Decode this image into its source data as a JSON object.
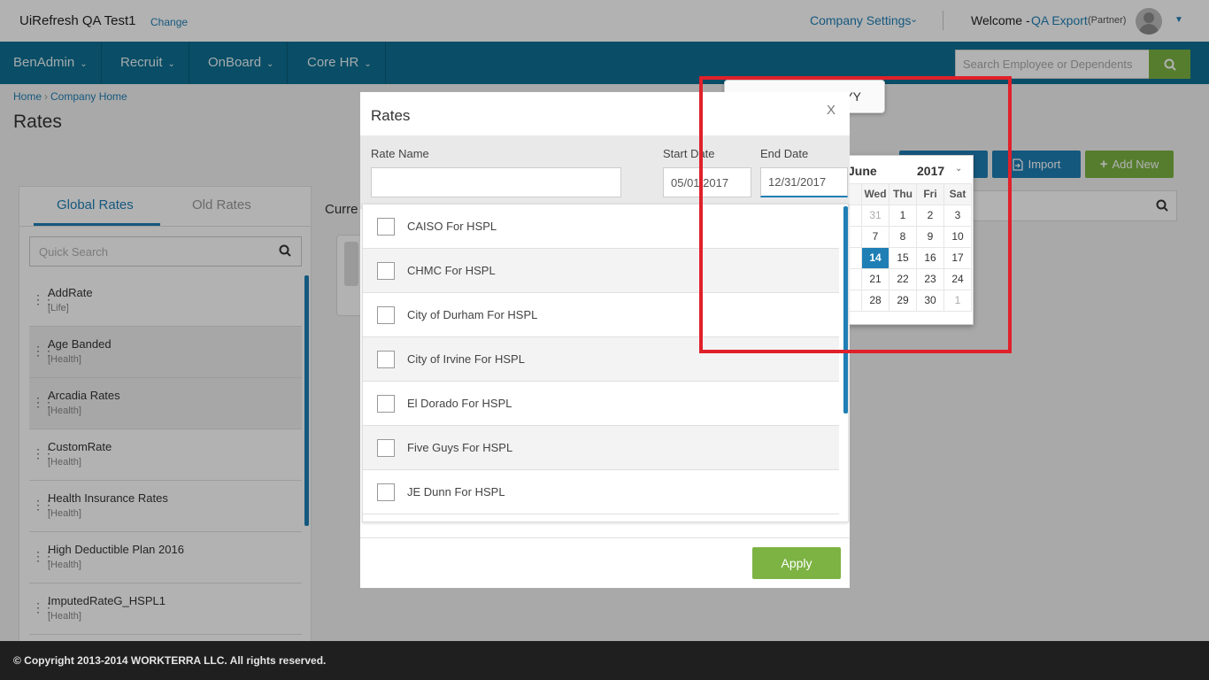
{
  "header": {
    "app_title": "UiRefresh QA Test1",
    "change_link": "Change",
    "company_settings": "Company Settings",
    "welcome": "Welcome -",
    "user": "QA Export",
    "role": "(Partner)"
  },
  "nav": {
    "items": [
      {
        "label": "BenAdmin"
      },
      {
        "label": "Recruit"
      },
      {
        "label": "OnBoard"
      },
      {
        "label": "Core HR"
      }
    ],
    "search_placeholder": "Search Employee or Dependents"
  },
  "breadcrumb": {
    "home": "Home",
    "company_home": "Company Home"
  },
  "page_title": "Rates",
  "left_panel": {
    "tabs": [
      "Global Rates",
      "Old Rates"
    ],
    "quick_search_placeholder": "Quick Search",
    "rates": [
      {
        "name": "AddRate",
        "type": "[Life]"
      },
      {
        "name": "Age Banded",
        "type": "[Health]"
      },
      {
        "name": "Arcadia Rates",
        "type": "[Health]"
      },
      {
        "name": "CustomRate",
        "type": "[Health]"
      },
      {
        "name": "Health Insurance Rates",
        "type": "[Health]"
      },
      {
        "name": "High Deductible Plan 2016",
        "type": "[Health]"
      },
      {
        "name": "ImputedRateG_HSPL1",
        "type": "[Health]"
      }
    ]
  },
  "main": {
    "current_label": "Curre",
    "import_label": "Import",
    "add_new_label": "Add New"
  },
  "tooltip": {
    "text": "Inform  t  MM/DD/YYYY"
  },
  "calendar": {
    "month": "June",
    "year": "2017",
    "weekdays": [
      "Wed",
      "Thu",
      "Fri",
      "Sat"
    ],
    "rows": [
      [
        "31",
        "1",
        "2",
        "3"
      ],
      [
        "7",
        "8",
        "9",
        "10"
      ],
      [
        "14",
        "15",
        "16",
        "17"
      ],
      [
        "21",
        "22",
        "23",
        "24"
      ],
      [
        "28",
        "29",
        "30",
        "1"
      ]
    ],
    "selected": "14"
  },
  "modal": {
    "title": "Rates",
    "close": "X",
    "rate_name_label": "Rate Name",
    "rate_name_value": "",
    "start_date_label": "Start Date",
    "start_date_value": "05/01/2017",
    "end_date_label": "End Date",
    "end_date_value": "12/31/2017",
    "options": [
      "CAISO For HSPL",
      "CHMC For HSPL",
      "City of Durham For HSPL",
      "City of Irvine For HSPL",
      "El Dorado For HSPL",
      "Five Guys For HSPL",
      "JE Dunn For HSPL"
    ],
    "apply": "Apply"
  },
  "footer": {
    "copyright": "© Copyright 2013-2014 WORKTERRA LLC. All rights reserved."
  },
  "colors": {
    "primary": "#0d6f92",
    "accent": "#1f7fb5",
    "green": "#7cb342",
    "annotation": "#e0202a"
  }
}
